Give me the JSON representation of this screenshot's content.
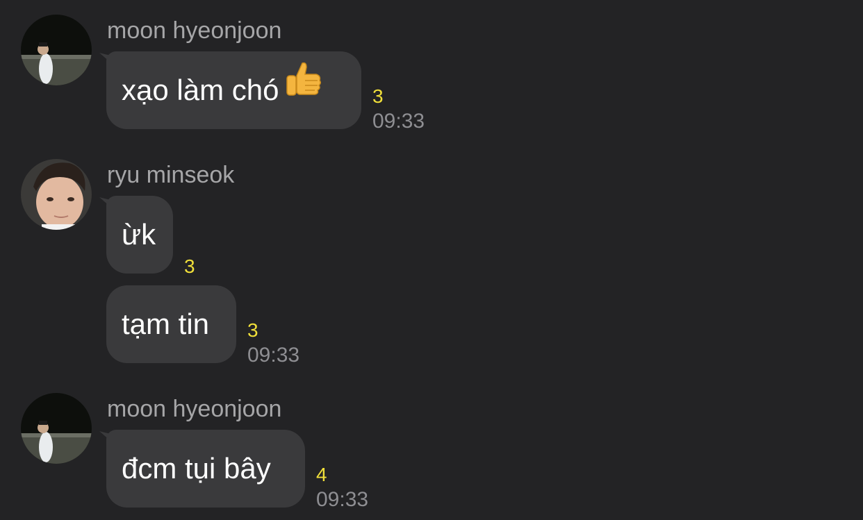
{
  "messages": [
    {
      "sender": "moon hyeonjoon",
      "avatar_icon": "avatar-night-figure",
      "bubbles": [
        {
          "text": "xạo làm chó",
          "emoji": "thumbs-up-icon",
          "unread": "3",
          "time": "09:33"
        }
      ]
    },
    {
      "sender": "ryu minseok",
      "avatar_icon": "avatar-face-photo",
      "bubbles": [
        {
          "text": "ừk",
          "unread": "3"
        },
        {
          "text": "tạm tin",
          "unread": "3",
          "time": "09:33"
        }
      ]
    },
    {
      "sender": "moon hyeonjoon",
      "avatar_icon": "avatar-night-figure",
      "bubbles": [
        {
          "text": "đcm tụi bây",
          "unread": "4",
          "time": "09:33"
        }
      ]
    }
  ],
  "colors": {
    "background": "#232325",
    "bubble": "#3a3a3c",
    "unread": "#f0df3a",
    "sender": "#a6a6a8",
    "time": "#8e8e92"
  }
}
